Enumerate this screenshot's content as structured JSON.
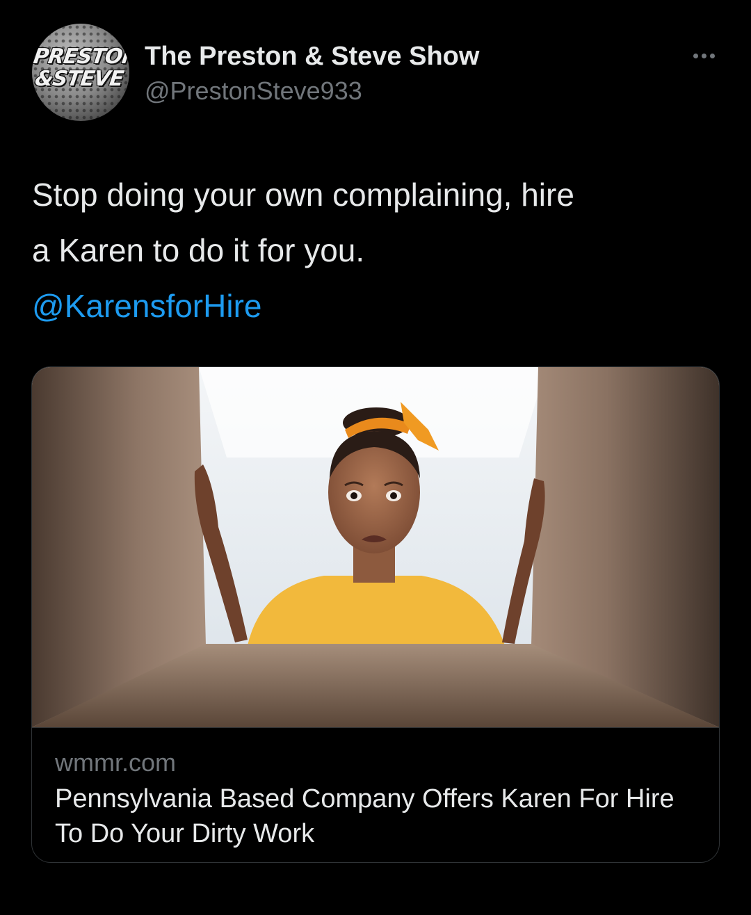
{
  "tweet": {
    "avatar_logo": "PRESTON & STEVE",
    "author_name": "The Preston & Steve Show",
    "author_handle": "@PrestonSteve933",
    "more_icon": "more-horizontal-icon",
    "text_lines": [
      "Stop doing your own complaining, hire",
      "a Karen to do it for you."
    ],
    "mention": "@KarensforHire"
  },
  "card": {
    "image_description": "woman with orange headband looking into cardboard box",
    "domain": "wmmr.com",
    "title": "Pennsylvania Based Company Offers Karen For Hire To Do Your Dirty Work"
  },
  "colors": {
    "background": "#000000",
    "primary_text": "#e7e9ea",
    "secondary_text": "#71767b",
    "link": "#1d9bf0",
    "border": "#2f3336"
  }
}
